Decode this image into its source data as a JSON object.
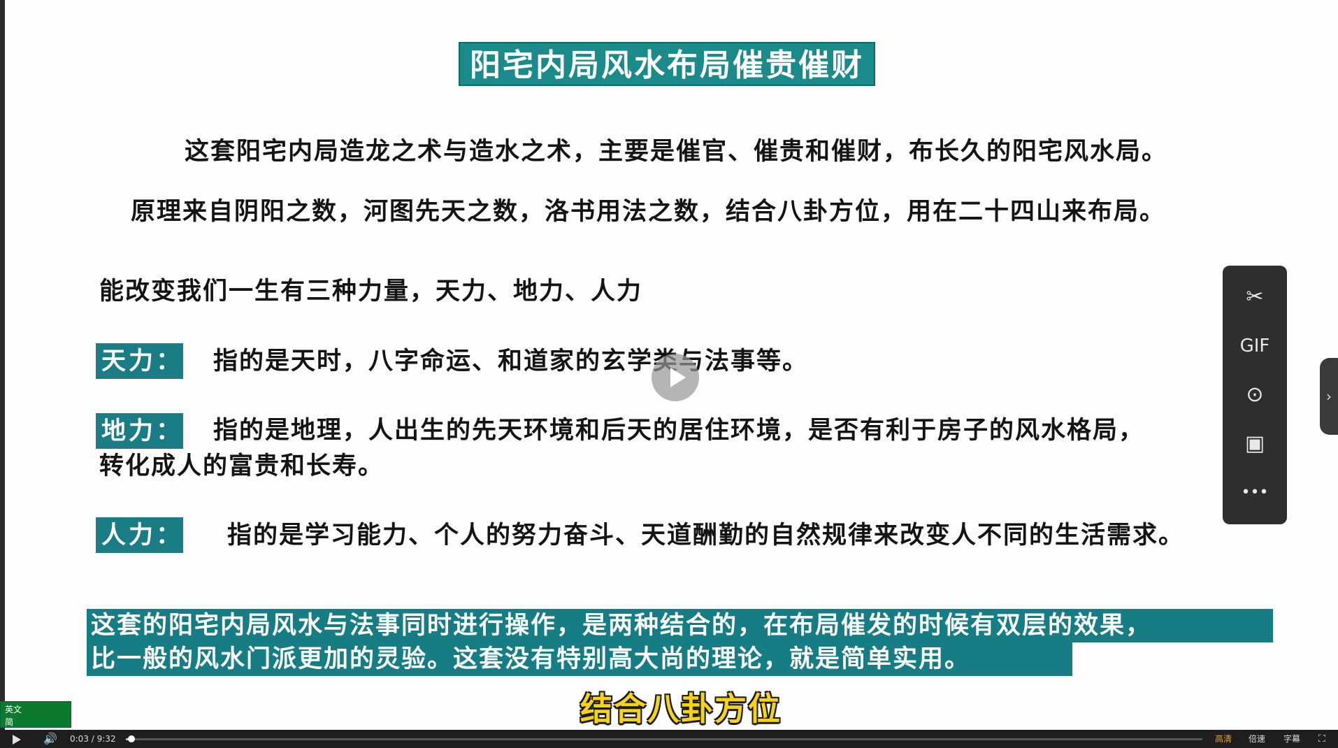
{
  "slide": {
    "title": "阳宅内局风水布局催贵催财",
    "para1": "这套阳宅内局造龙之术与造水之术，主要是催官、催贵和催财，布长久的阳宅风水局。",
    "para2": "原理来自阴阳之数，河图先天之数，洛书用法之数，结合八卦方位，用在二十四山来布局。",
    "para3": "能改变我们一生有三种力量，天力、地力、人力",
    "items": [
      {
        "tag": "天力：",
        "text": "指的是天时，八字命运、和道家的玄学类与法事等。"
      },
      {
        "tag": "地力：",
        "text": "指的是地理，人出生的先天环境和后天的居住环境，是否有利于房子的风水格局，",
        "text2": "转化成人的富贵和长寿。"
      },
      {
        "tag": "人力：",
        "text": "指的是学习能力、个人的努力奋斗、天道酬勤的自然规律来改变人不同的生活需求。"
      }
    ],
    "highlight": [
      "这套的阳宅内局风水与法事同时进行操作，是两种结合的，在布局催发的时候有双层的效果，",
      "比一般的风水门派更加的灵验。这套没有特别高大尚的理论，就是简单实用。"
    ]
  },
  "caption": "结合八卦方位",
  "toolbar": {
    "items": [
      {
        "icon": "scissors-icon",
        "glyph": "✂"
      },
      {
        "icon": "gif-icon",
        "glyph": "GIF"
      },
      {
        "icon": "play-circle-icon",
        "glyph": "⊙"
      },
      {
        "icon": "image-icon",
        "glyph": "▣"
      },
      {
        "icon": "more-icon",
        "glyph": "•••"
      }
    ]
  },
  "ime": {
    "row1": "英文",
    "row2": "简"
  },
  "player": {
    "current_time": "0:03",
    "separator": "/",
    "duration": "9:32",
    "progress_fraction": 0.005,
    "quality_label": "高清",
    "speed_label": "倍速",
    "subtitle_label": "字幕",
    "accent_color": "#f0a020"
  }
}
